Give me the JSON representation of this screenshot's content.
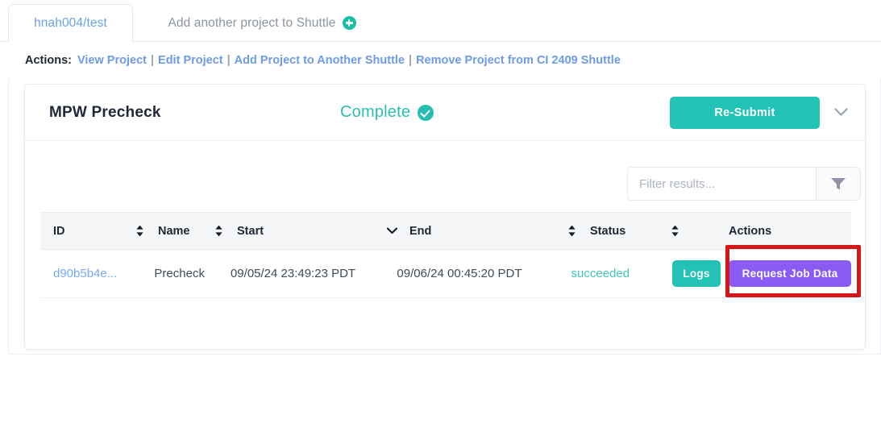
{
  "tabs": [
    {
      "label": "hnah004/test",
      "active": true
    },
    {
      "label": "Add another project to Shuttle",
      "active": false,
      "icon": "plus-circle-icon"
    }
  ],
  "actions": {
    "label": "Actions:",
    "separator": "|",
    "links": [
      "View Project",
      "Edit Project",
      "Add Project to Another Shuttle",
      "Remove Project from CI 2409 Shuttle"
    ]
  },
  "card": {
    "title": "MPW Precheck",
    "status_text": "Complete",
    "status_icon": "check-circle-icon",
    "resubmit_label": "Re-Submit",
    "collapse_icon": "chevron-down-icon"
  },
  "filter": {
    "placeholder": "Filter results...",
    "value": "",
    "button_icon": "funnel-icon"
  },
  "table": {
    "headers": {
      "id": "ID",
      "name": "Name",
      "start": "Start",
      "end": "End",
      "status": "Status",
      "actions": "Actions"
    },
    "sort_icons": {
      "id": "sort-updown-icon",
      "name": "sort-updown-icon",
      "start": "chevron-down-icon",
      "end": "sort-updown-icon",
      "status": "sort-updown-icon"
    },
    "rows": [
      {
        "id": "d90b5b4e...",
        "name": "Precheck",
        "start": "09/05/24 23:49:23 PDT",
        "end": "09/06/24 00:45:20 PDT",
        "status": "succeeded",
        "logs_label": "Logs",
        "request_label": "Request Job Data"
      }
    ]
  },
  "colors": {
    "teal": "#22c2b6",
    "purple": "#8a5cf5",
    "link_blue": "#6f9ae8",
    "tab_blue": "#6aa3e0",
    "status_green": "#43c4ba",
    "highlight_red": "#d31717"
  }
}
